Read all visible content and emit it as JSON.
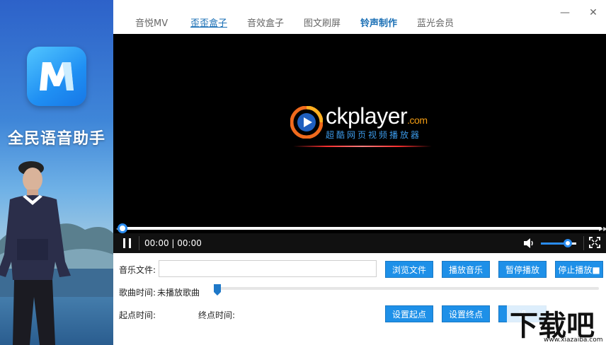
{
  "sidebar": {
    "app_name": "全民语音助手",
    "logo_letter": "M"
  },
  "tabs": [
    {
      "label": "音悦MV"
    },
    {
      "label": "歪歪盒子"
    },
    {
      "label": "音效盒子"
    },
    {
      "label": "图文刷屏"
    },
    {
      "label": "铃声制作"
    },
    {
      "label": "蓝光会员"
    }
  ],
  "window": {
    "minimize": "—",
    "close": "✕"
  },
  "player": {
    "brand": "ckplayer",
    "brand_suffix": ".com",
    "subtitle": "超酷网页视频播放器",
    "time": "00:00 | 00:00",
    "progress_fraction": 0.0,
    "volume_fraction": 0.75
  },
  "form": {
    "music_file_label": "音乐文件:",
    "music_file_value": "",
    "browse_label": "浏览文件",
    "play_label": "播放音乐",
    "pause_label": "暂停播放",
    "stop_label": "停止播放■",
    "song_time_label": "歌曲时间:",
    "song_time_value": "未播放歌曲",
    "song_position_fraction": 0.0,
    "start_point_label": "起点时间:",
    "end_point_label": "终点时间:",
    "set_start_label": "设置起点",
    "set_end_label": "设置终点",
    "partial_button_label": "设"
  },
  "watermark": {
    "text": "下载吧",
    "url": "www.xiazaiba.com"
  },
  "colors": {
    "accent": "#1e90e8",
    "player_bg": "#000000",
    "tab_active": "#1a6fb5"
  }
}
